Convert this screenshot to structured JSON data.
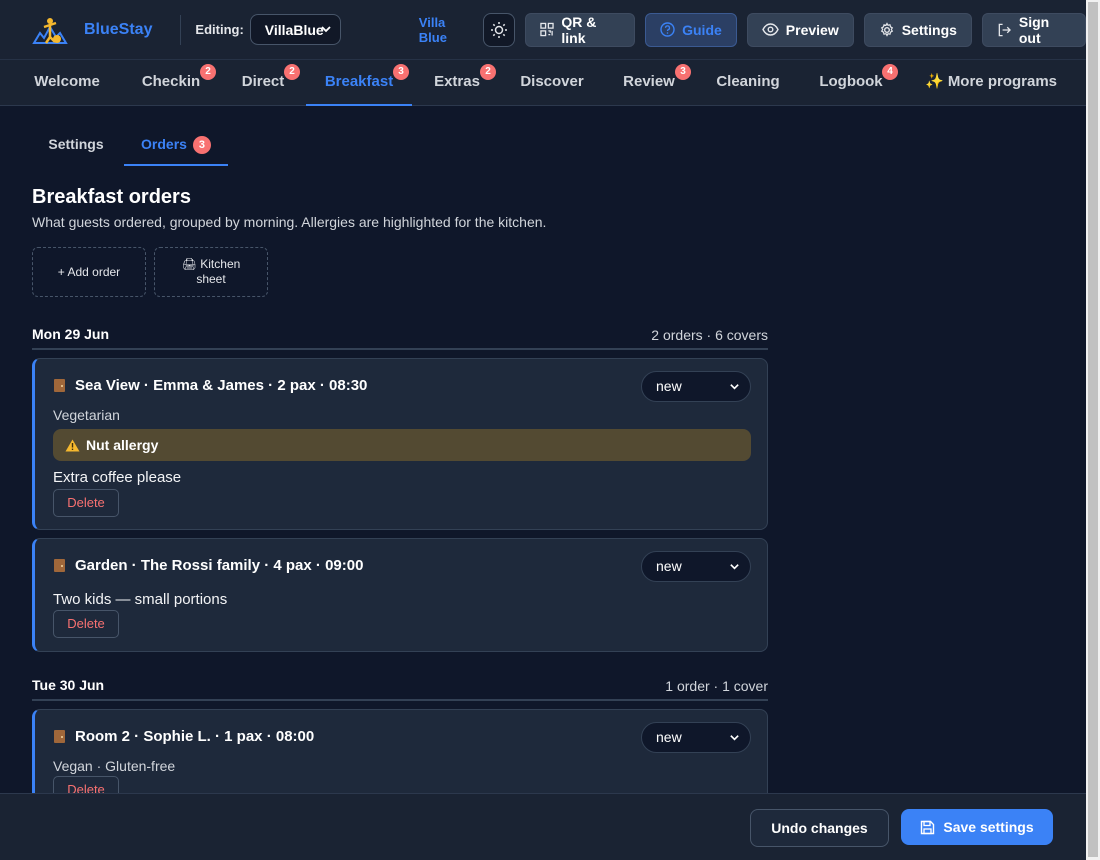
{
  "header": {
    "brand": "BlueStay",
    "editing_label": "Editing:",
    "property_selected": "VillaBlue",
    "property_name": "Villa Blue",
    "buttons": {
      "qr": "QR & link",
      "guide": "Guide",
      "preview": "Preview",
      "settings": "Settings",
      "signout": "Sign out"
    }
  },
  "nav": {
    "tabs": [
      {
        "label": "Welcome",
        "badge": ""
      },
      {
        "label": "Checkin",
        "badge": "2"
      },
      {
        "label": "Direct",
        "badge": "2"
      },
      {
        "label": "Breakfast",
        "badge": "3"
      },
      {
        "label": "Extras",
        "badge": "2"
      },
      {
        "label": "Discover",
        "badge": ""
      },
      {
        "label": "Review",
        "badge": "3"
      },
      {
        "label": "Cleaning",
        "badge": ""
      },
      {
        "label": "Logbook",
        "badge": "4"
      },
      {
        "label": "✨ More programs",
        "badge": ""
      }
    ],
    "active": "Breakfast"
  },
  "subtabs": {
    "settings": "Settings",
    "orders": "Orders",
    "orders_badge": "3",
    "active": "Orders"
  },
  "main": {
    "title": "Breakfast orders",
    "subtitle": "What guests ordered, grouped by morning. Allergies are highlighted for the kitchen.",
    "add_order": "+ Add order",
    "kitchen_sheet_icon": "🖨",
    "kitchen_sheet_line1": "Kitchen",
    "kitchen_sheet_line2": "sheet"
  },
  "days": [
    {
      "title": "Mon 29 Jun",
      "summary": "2 orders · 6 covers",
      "orders": [
        {
          "title": "Sea View · Emma & James · 2 pax · 08:30",
          "status": "new",
          "diet": "Vegetarian",
          "allergy": "Nut allergy",
          "note": "Extra coffee please",
          "delete": "Delete"
        },
        {
          "title": "Garden · The Rossi family · 4 pax · 09:00",
          "status": "new",
          "note": "Two kids — small portions",
          "delete": "Delete"
        }
      ]
    },
    {
      "title": "Tue 30 Jun",
      "summary": "1 order · 1 cover",
      "orders": [
        {
          "title": "Room 2 · Sophie L. · 1 pax · 08:00",
          "status": "new",
          "diet": "Vegan · Gluten-free",
          "delete": "Delete"
        }
      ]
    }
  ],
  "footer": {
    "undo": "Undo changes",
    "save": "Save settings"
  },
  "colors": {
    "accent": "#3b82f6",
    "badge": "#f87171",
    "allergy_bg": "#534a32",
    "background": "#0f172a"
  }
}
